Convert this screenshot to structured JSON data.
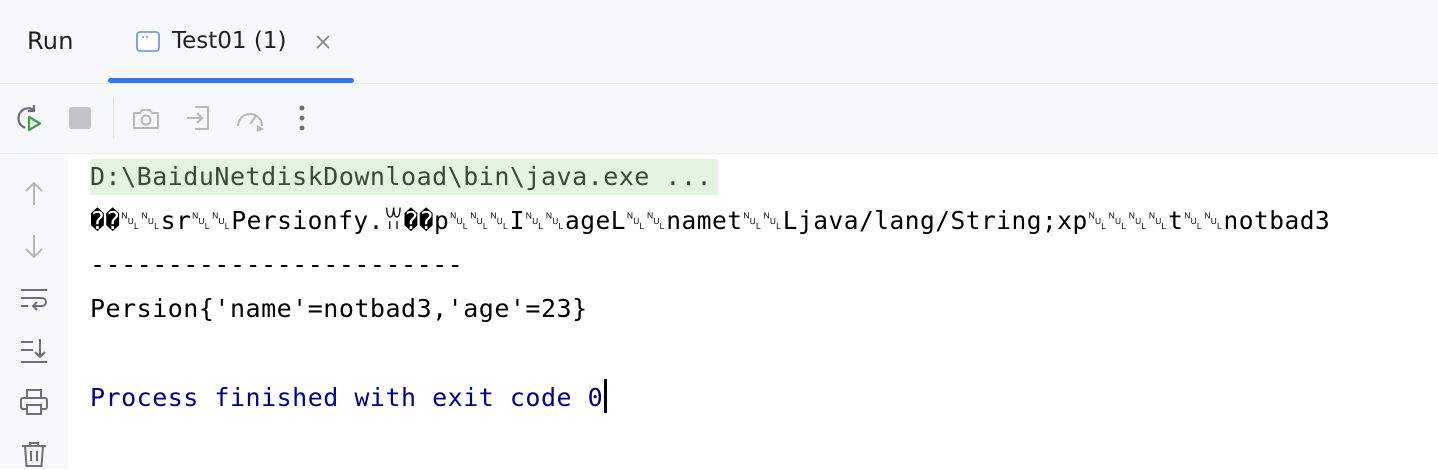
{
  "tool_window": {
    "title": "Run",
    "tab": {
      "label": "Test01 (1)",
      "icon": "console-tab-icon",
      "close_icon": "close-icon"
    },
    "accent_color": "#3574f0"
  },
  "toolbar": {
    "buttons": [
      {
        "name": "rerun",
        "icon": "rerun-icon"
      },
      {
        "name": "stop",
        "icon": "stop-icon"
      },
      {
        "name": "screenshot",
        "icon": "camera-icon"
      },
      {
        "name": "restore-layout",
        "icon": "export-icon"
      },
      {
        "name": "profiler",
        "icon": "speedometer-icon"
      },
      {
        "name": "more",
        "icon": "more-vertical-icon"
      }
    ]
  },
  "gutter": {
    "buttons": [
      {
        "name": "scroll-up",
        "icon": "arrow-up-icon"
      },
      {
        "name": "scroll-down",
        "icon": "arrow-down-icon"
      },
      {
        "name": "soft-wrap",
        "icon": "soft-wrap-icon"
      },
      {
        "name": "scroll-to-end",
        "icon": "scroll-to-end-icon"
      },
      {
        "name": "print",
        "icon": "printer-icon"
      },
      {
        "name": "clear",
        "icon": "trash-icon"
      }
    ]
  },
  "console": {
    "command_line": "D:\\BaiduNetdiskDownload\\bin\\java.exe ...",
    "output_line_1": "��\u0000\u0005sr\u0000\u0007Persionfy.ꀕ��p\u0002\u0000\u0002I\u0000\u0003ageL\u0000\u0004namet\u0000\u0012Ljava/lang/String;xp\u0000\u0000\u0000\u0017t\u0000\u0007notbad3",
    "output_line_1_display": "��␀␀sr␀␀Persionfy.ꀕ��p␀␀␀I␀␀ageL␀␀namet␀␀Ljava/lang/String;xp␀␀␀␀t␀␀notbad3",
    "separator": "------------------------",
    "output_line_3": "Persion{'name'=notbad3,'age'=23}",
    "exit_message": "Process finished with exit code 0",
    "colors": {
      "command_bg": "#e4f3e2",
      "exit_text": "#000080"
    }
  }
}
